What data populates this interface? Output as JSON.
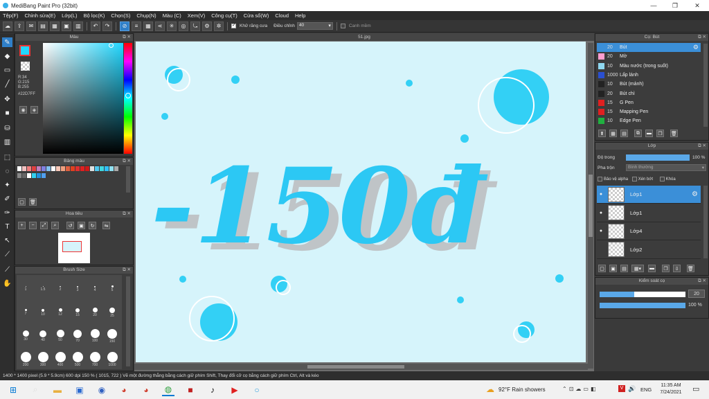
{
  "window": {
    "title": "MediBang Paint Pro (32bit)",
    "min": "—",
    "max": "❐",
    "close": "✕"
  },
  "menu": [
    "Tệp(F)",
    "Chỉnh sửa(E)",
    "Lớp(L)",
    "Bộ lọc(K)",
    "Chọn(S)",
    "Chụp(N)",
    "Màu (C)",
    "Xem(V)",
    "Công cụ(T)",
    "Cửa sổ(W)",
    "Cloud",
    "Help"
  ],
  "toolbar": {
    "antialias_label": "Khử răng cưa",
    "adjust_label": "Điều chỉnh",
    "adjust_value": "40",
    "smooth_label": "Canh mềm"
  },
  "color_panel": {
    "title": "Màu",
    "r": "R:34",
    "g": "G:215",
    "b": "B:255",
    "hex": "#22D7FF",
    "fg_color": "#22D7FF"
  },
  "palette_panel": {
    "title": "Bảng màu"
  },
  "nav_panel": {
    "title": "Hoa tiêu"
  },
  "brush_size_panel": {
    "title": "Brush Size",
    "sizes": [
      "1",
      "1.5",
      "2",
      "3",
      "4",
      "5",
      "7",
      "10",
      "12",
      "15",
      "20",
      "25",
      "30",
      "40",
      "50",
      "70",
      "100",
      "150",
      "200",
      "300",
      "400",
      "500",
      "700",
      "1000"
    ]
  },
  "document": {
    "tab": "51.jpg"
  },
  "canvas_text": "-150đ",
  "brush_panel": {
    "title": "Cọ: Bút",
    "items": [
      {
        "size": "20",
        "name": "Bút",
        "color": "#3b8fd8"
      },
      {
        "size": "20",
        "name": "Mờ",
        "color": "#ff9ed0"
      },
      {
        "size": "10",
        "name": "Màu nước (trong suốt)",
        "color": "#8fd8f0"
      },
      {
        "size": "1000",
        "name": "Lấp lánh",
        "color": "#2a4fd0"
      },
      {
        "size": "10",
        "name": "Bút (mảnh)",
        "color": "#222222"
      },
      {
        "size": "20",
        "name": "Bút chì",
        "color": "#222222"
      },
      {
        "size": "15",
        "name": "G Pen",
        "color": "#e02020"
      },
      {
        "size": "15",
        "name": "Mapping Pen",
        "color": "#e02020"
      },
      {
        "size": "10",
        "name": "Edge Pen",
        "color": "#20b040"
      }
    ]
  },
  "layer_panel": {
    "title": "Lớp",
    "opacity_label": "Độ trong",
    "opacity_value": "100 %",
    "opacity_fraction": 1.0,
    "blend_label": "Pha trộn",
    "blend_value": "Bình thường",
    "protect_alpha": "Bảo vệ alpha",
    "clipping": "Xén bớt",
    "lock": "Khóa",
    "layers": [
      {
        "name": "Lớp1"
      },
      {
        "name": "Lớp1"
      },
      {
        "name": "Lớp4"
      },
      {
        "name": "Lớp2"
      }
    ]
  },
  "control_panel": {
    "title": "Kiểm soát cọ",
    "size_value": "20",
    "size_fraction": 0.4,
    "opacity_value": "100 %",
    "opacity_fraction": 1.0
  },
  "status": "1400 * 1400 pixel   (5.9 * 5.9cm)  600 dpi   150 %   ( 1015, 722 )   Vẽ một đường thẳng bằng cách giữ phím Shift, Thay đổi cỡ cọ bằng cách giữ phím Ctrl, Alt và kéo",
  "taskbar": {
    "weather": "92°F  Rain showers",
    "lang": "ENG",
    "time": "11:35 AM",
    "date": "7/24/2021"
  }
}
